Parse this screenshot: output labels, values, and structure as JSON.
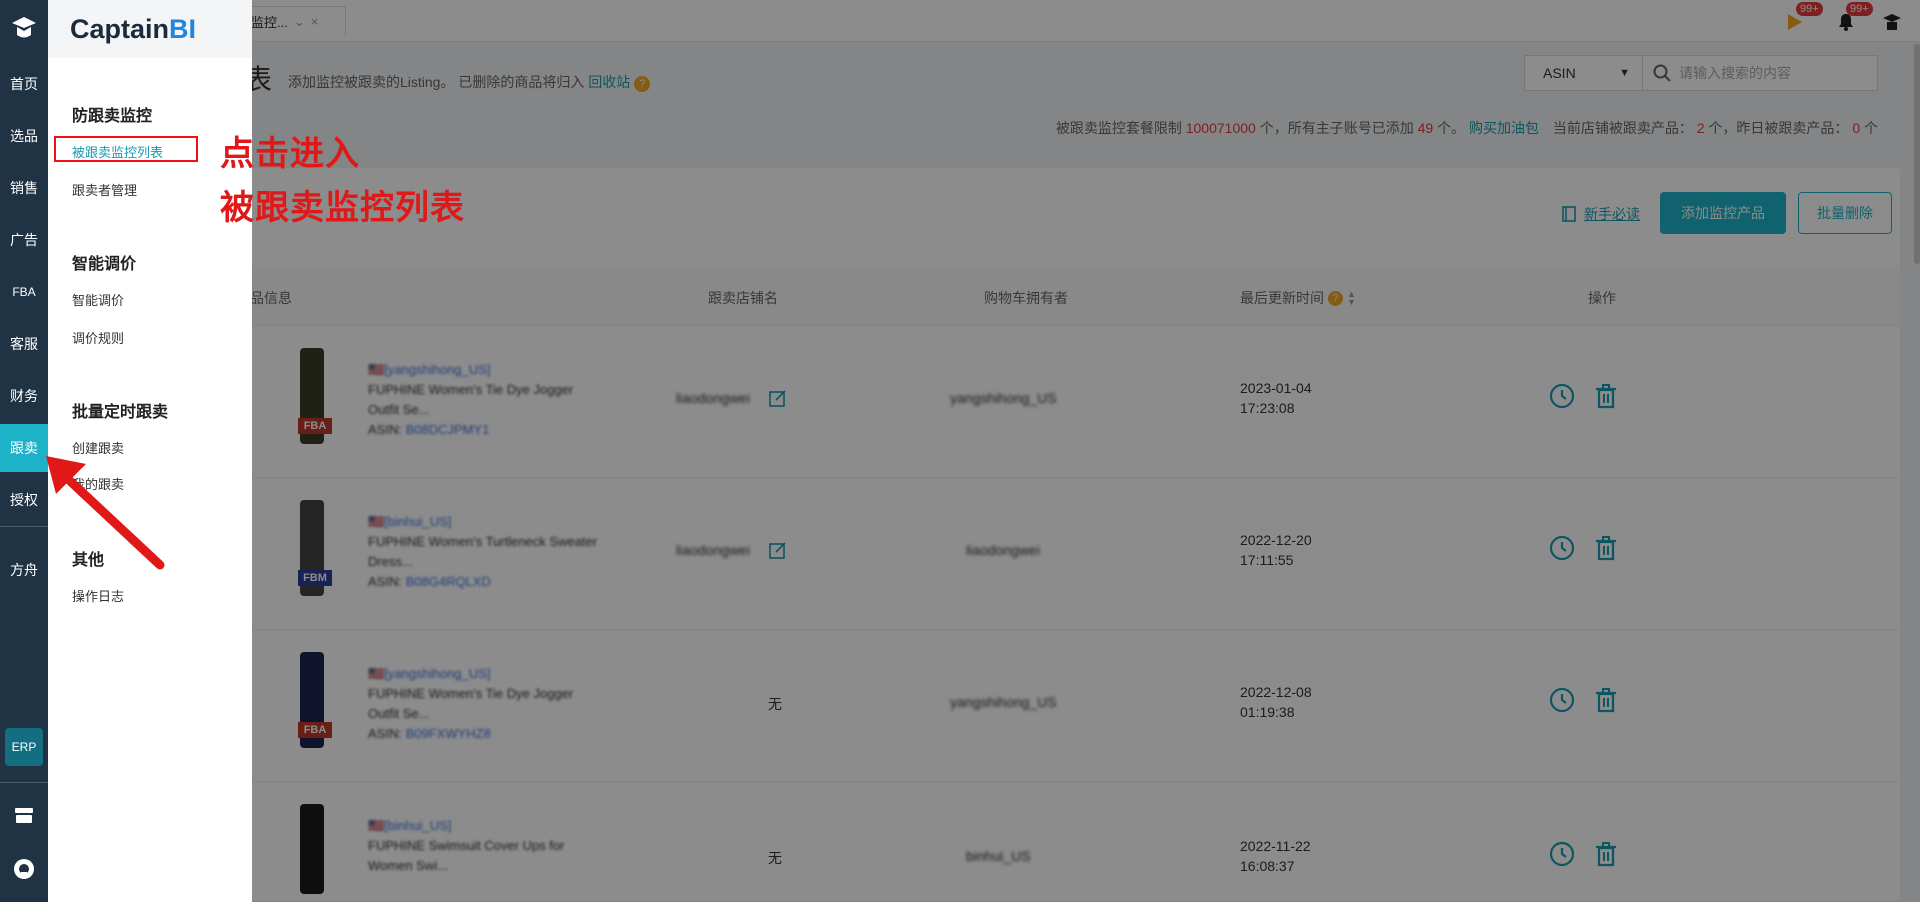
{
  "brand": {
    "name_main": "Captain",
    "name_accent": "BI"
  },
  "rail": {
    "items": [
      "首页",
      "选品",
      "销售",
      "广告",
      "FBA",
      "客服",
      "财务",
      "跟卖",
      "授权",
      "方舟"
    ],
    "active_index": 7,
    "erp": "ERP"
  },
  "tab": {
    "label": "监控...",
    "close": "×"
  },
  "header": {
    "title": "表",
    "hint_text": "添加监控被跟卖的Listing。  已删除的商品将归入",
    "recycle_link": "回收站",
    "badge_count_1": "99+",
    "badge_count_2": "99+"
  },
  "search": {
    "select_value": "ASIN",
    "placeholder": "请输入搜索的内容"
  },
  "stats": {
    "label1": "被跟卖监控套餐限制",
    "limit": "100071000",
    "label2": "个，所有主子账号已添加",
    "added": "49",
    "label3": "个。",
    "buy_link": "购买加油包",
    "label4": "当前店铺被跟卖产品：",
    "current": "2",
    "label5": "个，昨日被跟卖产品：",
    "yesterday": "0",
    "label6": "个"
  },
  "toolbar": {
    "newbie": "新手必读",
    "add": "添加监控产品",
    "batch_delete": "批量删除"
  },
  "table": {
    "headers": {
      "product": "品信息",
      "seller": "跟卖店铺名",
      "buybox": "购物车拥有者",
      "updated": "最后更新时间",
      "ops": "操作"
    },
    "rows": [
      {
        "store": "[yangshihong_US]",
        "title1": "FUPHINE Women's Tie Dye Jogger",
        "title2": "Outfit Se...",
        "asin_label": "ASIN:",
        "asin": "B08DCJPMY1",
        "fulfill": "FBA",
        "seller": "liaodongwei",
        "buybox": "yangshihong_US",
        "buybox_red": false,
        "date": "2023-01-04",
        "time": "17:23:08"
      },
      {
        "store": "[binhui_US]",
        "title1": "FUPHINE Women's Turtleneck Sweater",
        "title2": "Dress...",
        "asin_label": "ASIN:",
        "asin": "B08G4RQLXD",
        "fulfill": "FBM",
        "seller": "liaodongwei",
        "buybox": "liaodongwei",
        "buybox_red": true,
        "date": "2022-12-20",
        "time": "17:11:55"
      },
      {
        "store": "[yangshihong_US]",
        "title1": "FUPHINE Women's Tie Dye Jogger",
        "title2": "Outfit Se...",
        "asin_label": "ASIN:",
        "asin": "B09FXWYHZ8",
        "fulfill": "FBA",
        "seller": "无",
        "buybox": "yangshihong_US",
        "buybox_red": false,
        "date": "2022-12-08",
        "time": "01:19:38"
      },
      {
        "store": "[binhui_US]",
        "title1": "FUPHINE Swimsuit Cover Ups for",
        "title2": "Women Swi...",
        "asin_label": "ASIN:",
        "asin": "",
        "fulfill": "",
        "seller": "无",
        "buybox": "binhui_US",
        "buybox_red": false,
        "date": "2022-11-22",
        "time": "16:08:37"
      }
    ]
  },
  "flyout": {
    "sections": [
      {
        "title": "防跟卖监控",
        "items": [
          "被跟卖监控列表",
          "跟卖者管理"
        ]
      },
      {
        "title": "智能调价",
        "items": [
          "智能调价",
          "调价规则"
        ]
      },
      {
        "title": "批量定时跟卖",
        "items": [
          "创建跟卖",
          "我的跟卖"
        ]
      },
      {
        "title": "其他",
        "items": [
          "操作日志"
        ]
      }
    ]
  },
  "annotation": {
    "line1": "点击进入",
    "line2": "被跟卖监控列表"
  },
  "colors": {
    "accent": "#1db2c8",
    "rail": "#1f3345",
    "annotation": "#e01818"
  }
}
